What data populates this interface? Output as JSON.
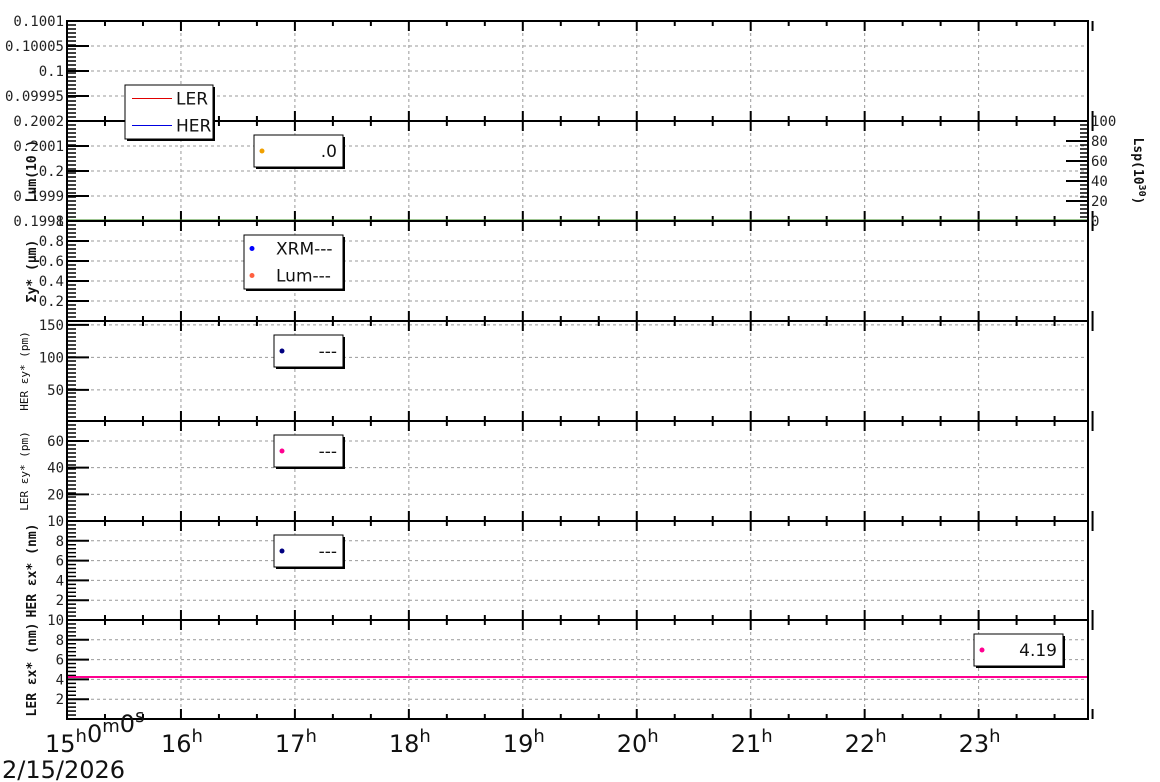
{
  "chart_data": [
    {
      "type": "line",
      "ylabel": "",
      "ylim": [
        0.0999,
        0.1001
      ],
      "yticks": [
        "0.1001",
        "0.10005",
        "0.1",
        "0.09995"
      ],
      "legend": [
        {
          "label": "LER",
          "color": "#e00000",
          "kind": "line"
        },
        {
          "label": "HER",
          "color": "#0000e0",
          "kind": "line"
        }
      ],
      "series": []
    },
    {
      "type": "line",
      "ylabel": "Lum(10  )",
      "ylim": [
        0.1998,
        0.2002
      ],
      "yticks": [
        "0.2002",
        "0.2001",
        "0.2",
        "0.1999",
        "0.1998"
      ],
      "y2label": "Lsp(10",
      "y2sup": "30",
      "y2close": ")",
      "y2lim": [
        0,
        100
      ],
      "y2ticks": [
        "0",
        "20",
        "40",
        "60",
        "80",
        "100"
      ],
      "legend": [
        {
          "label": ".0",
          "color": "#f0a000",
          "kind": "dot"
        }
      ],
      "series": [
        {
          "color": "#3a8a20",
          "axis": "y2",
          "y": 0
        }
      ]
    },
    {
      "type": "scatter",
      "ylabel": "Σy* (μm)",
      "ylim": [
        0,
        1
      ],
      "yticks": [
        "1",
        "0.8",
        "0.6",
        "0.4",
        "0.2"
      ],
      "legend": [
        {
          "label": "XRM---",
          "color": "#0000ff",
          "kind": "dot"
        },
        {
          "label": "Lum---",
          "color": "#ff6040",
          "kind": "dot"
        }
      ],
      "series": []
    },
    {
      "type": "scatter",
      "ylabel": "HER εy* (pm)",
      "ylim": [
        2,
        156
      ],
      "yticks": [
        "150",
        "100",
        "50"
      ],
      "legend": [
        {
          "label": "---",
          "color": "#000080",
          "kind": "dot"
        }
      ],
      "series": []
    },
    {
      "type": "scatter",
      "ylabel": "LER εy* (pm)",
      "ylim": [
        0,
        75
      ],
      "yticks": [
        "60",
        "40",
        "20"
      ],
      "legend": [
        {
          "label": "---",
          "color": "#ff0090",
          "kind": "dot"
        }
      ],
      "series": []
    },
    {
      "type": "scatter",
      "ylabel": "HER εx* (nm)",
      "ylim": [
        0,
        10
      ],
      "yticks": [
        "10",
        "8",
        "6",
        "4",
        "2"
      ],
      "legend": [
        {
          "label": "---",
          "color": "#000080",
          "kind": "dot"
        }
      ],
      "series": []
    },
    {
      "type": "line",
      "ylabel": "LER εx* (nm)",
      "ylim": [
        0,
        10
      ],
      "yticks": [
        "10",
        "8",
        "6",
        "4",
        "2"
      ],
      "legend": [
        {
          "label": "4.19",
          "color": "#ff0090",
          "kind": "dot"
        }
      ],
      "series": [
        {
          "color": "#ff0090",
          "y": 4.19
        }
      ]
    }
  ],
  "x_axis": {
    "range_hours": [
      15,
      23.96
    ],
    "first_label": {
      "h": "15",
      "m": "0",
      "s": "0"
    },
    "labels": [
      "16",
      "17",
      "18",
      "19",
      "20",
      "21",
      "22",
      "23"
    ],
    "hour_sup": "h",
    "min_sup": "m",
    "sec_sup": "s",
    "date": "2/15/2026",
    "grid": true
  }
}
